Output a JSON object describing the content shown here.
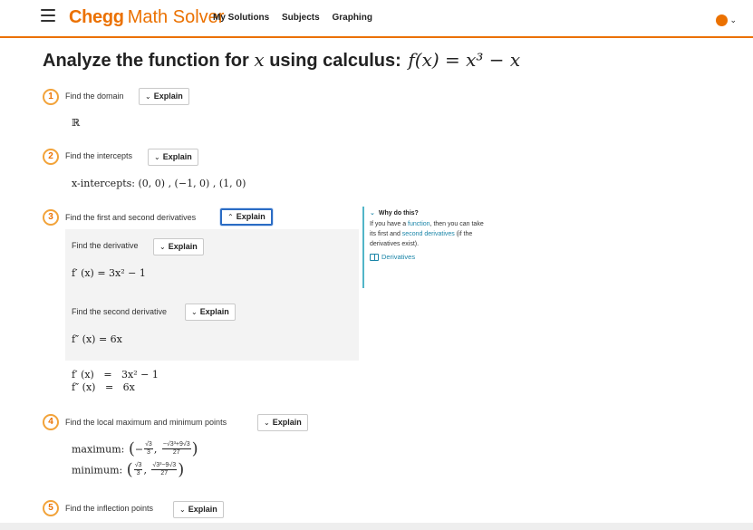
{
  "header": {
    "brand_chegg": "Chegg",
    "brand_sub": "Math Solver",
    "nav": [
      "My Solutions",
      "Subjects",
      "Graphing"
    ],
    "accent_color": "#eb7100"
  },
  "title": {
    "prefix": "Analyze the function for",
    "var": "x",
    "mid": "using calculus:",
    "func": "f(x) = x³ − x"
  },
  "explain_label": "Explain",
  "steps": [
    {
      "num": "1",
      "label": "Find the domain",
      "result": "ℝ"
    },
    {
      "num": "2",
      "label": "Find the intercepts",
      "result": "x-intercepts:  (0, 0) , (−1, 0) , (1, 0)"
    },
    {
      "num": "3",
      "label": "Find the first and second derivatives",
      "substeps": [
        {
          "label": "Find the derivative",
          "result": "f′ (x) = 3x² − 1"
        },
        {
          "label": "Find the second derivative",
          "result": "f″ (x) = 6x"
        }
      ],
      "summary": [
        "f′ (x)   =   3x² − 1",
        "f″ (x)   =   6x"
      ]
    },
    {
      "num": "4",
      "label": "Find the local maximum and minimum points",
      "max_label": "maximum:",
      "min_label": "minimum:",
      "max_x_num": "√3",
      "max_x_den": "3",
      "max_y_num": "−√3³+9√3",
      "max_y_den": "27",
      "min_x_num": "√3",
      "min_x_den": "3",
      "min_y_num": "√3³−9√3",
      "min_y_den": "27"
    },
    {
      "num": "5",
      "label": "Find the inflection points"
    }
  ],
  "why_panel": {
    "title": "Why do this?",
    "text_1": "If you have a ",
    "link_function": "function",
    "text_2": ", then you can take its first and ",
    "link_second": "second derivatives",
    "text_3": " (if the derivatives exist).",
    "link_label": "Derivatives"
  }
}
